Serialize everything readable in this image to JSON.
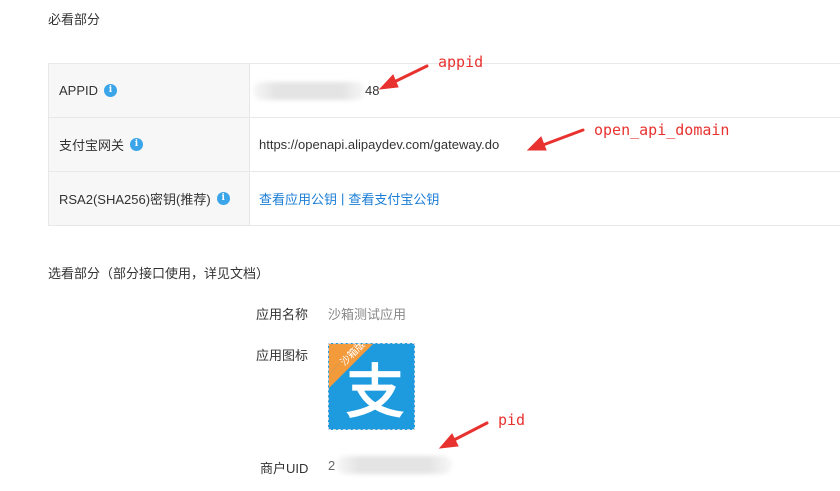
{
  "required_section": {
    "title": "必看部分",
    "rows": [
      {
        "label": "APPID",
        "value_suffix": "48"
      },
      {
        "label": "支付宝网关",
        "value": "https://openapi.alipaydev.com/gateway.do"
      },
      {
        "label": "RSA2(SHA256)密钥(推荐)",
        "link1": "查看应用公钥",
        "separator": "|",
        "link2": "查看支付宝公钥"
      }
    ],
    "info_glyph": "i"
  },
  "optional_section": {
    "title": "选看部分（部分接口使用，详见文档）",
    "app_name_label": "应用名称",
    "app_name_value": "沙箱测试应用",
    "app_icon_label": "应用图标",
    "app_icon_char": "支",
    "app_icon_badge": "沙箱版",
    "uid_label": "商户UID",
    "uid_value_prefix": "2"
  },
  "annotations": {
    "appid": "appid",
    "domain": "open_api_domain",
    "pid": "pid"
  },
  "colors": {
    "link": "#1a7dd6",
    "info_icon": "#3aa5e8",
    "annotation": "#e8322f",
    "app_icon_bg": "#1e9bdf",
    "badge": "#f39a3b"
  }
}
